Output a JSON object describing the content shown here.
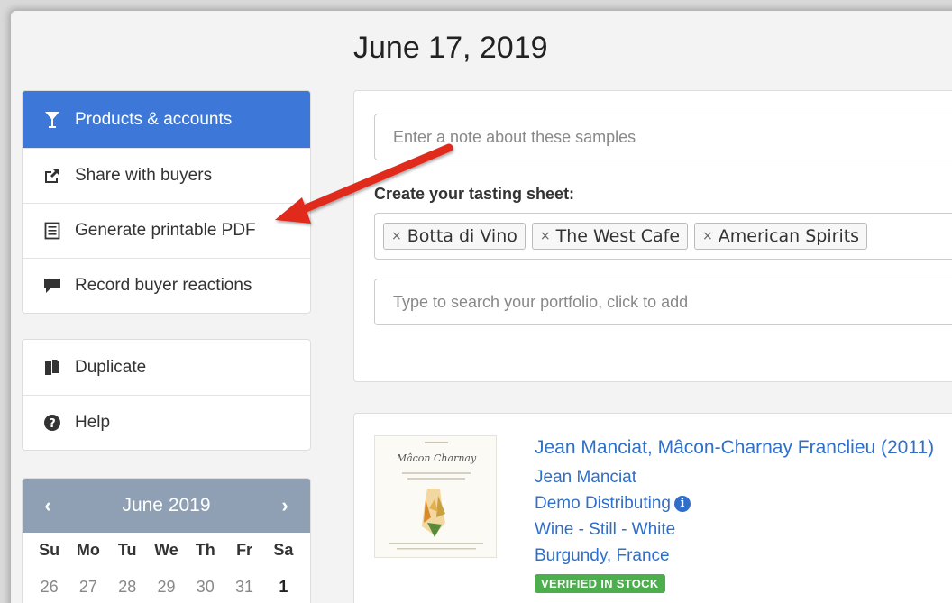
{
  "page": {
    "date_title": "June 17, 2019"
  },
  "sidebar": {
    "primary": [
      {
        "label": "Products & accounts",
        "icon": "cocktail-glass-icon",
        "active": true
      },
      {
        "label": "Share with buyers",
        "icon": "share-icon"
      },
      {
        "label": "Generate printable PDF",
        "icon": "document-icon"
      },
      {
        "label": "Record buyer reactions",
        "icon": "comment-icon"
      }
    ],
    "secondary": [
      {
        "label": "Duplicate",
        "icon": "copy-icon"
      },
      {
        "label": "Help",
        "icon": "help-icon"
      }
    ]
  },
  "calendar": {
    "month_label": "June 2019",
    "prev": "‹",
    "next": "›",
    "weekdays": [
      "Su",
      "Mo",
      "Tu",
      "We",
      "Th",
      "Fr",
      "Sa"
    ],
    "first_row": [
      "26",
      "27",
      "28",
      "29",
      "30",
      "31",
      "1"
    ]
  },
  "tasting": {
    "note_placeholder": "Enter a note about these samples",
    "sheet_label": "Create your tasting sheet:",
    "tags": [
      "Botta di Vino",
      "The West Cafe",
      "American Spirits"
    ],
    "tag_remove": "×",
    "search_placeholder": "Type to search your portfolio, click to add"
  },
  "product": {
    "title": "Jean Manciat, Mâcon-Charnay Franclieu (2011)",
    "producer": "Jean Manciat",
    "distributor": "Demo Distributing",
    "type": "Wine - Still - White",
    "region": "Burgundy, France",
    "badge": "VERIFIED IN STOCK",
    "label_image_text": "Mâcon Charnay"
  },
  "colors": {
    "accent": "#3d78d8",
    "link": "#2f6fc9",
    "badge": "#4cae4c",
    "calendar_header": "#8fa0b5",
    "callout_arrow": "#e0291c"
  }
}
